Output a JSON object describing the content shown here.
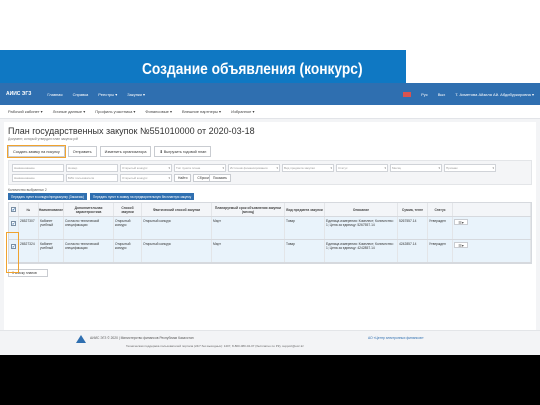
{
  "slide": {
    "title": "Создание объявления (конкурс)"
  },
  "topnav": {
    "logo": "АИИС ЭГЗ",
    "items": [
      "Главная",
      "Справка",
      "Реестры ▾",
      "Закупки ▾"
    ],
    "right": [
      "Рус",
      "Вых",
      "Т. Ахметова Айзиля Ай. Абдибуркировна ▾"
    ]
  },
  "subnav": {
    "items": [
      "Рабочий кабинет ▾",
      "Личные данные ▾",
      "Профиль участника ▾",
      "Финансовые ▾",
      "Внешние партнеры ▾",
      "Избранное ▾"
    ]
  },
  "page": {
    "title": "План государственных закупок №551010000 от 2020-03-18",
    "doc_note": "Документ, который утвердил план закупок pdf"
  },
  "toolbar": {
    "create": "Создать заявку на покупку",
    "send": "Отправить",
    "change_org": "Изменить организатора",
    "export": "Выгрузить годовой план"
  },
  "filters": {
    "row1": [
      "Наименование",
      "Номер",
      "Открытый конкурс",
      "Тип пункта плана",
      "Источник финансирования",
      "Вид предмета закупки",
      "Статус",
      "Месяц",
      "Признак"
    ],
    "row2": [
      "Наименование",
      "БИН пользователя",
      "Открытый конкурс"
    ],
    "search": "Найти",
    "reset": "Сбросить",
    "show": "Показать"
  },
  "selection": {
    "count_text": "Количество выбранных 2"
  },
  "actions": {
    "create_notice": "Передать пункт в конкурс/предзакупку (Заказчик)",
    "create_pred": "Передать пункт в заявку на предварительную бесплатную закупку"
  },
  "table": {
    "headers": [
      "",
      "№",
      "Наименование",
      "Дополнительная характеристика",
      "Способ закупки",
      "Фактический способ закупки",
      "Планируемый срок объявления закупки (месяц)",
      "Вид предмета закупки",
      "Описание",
      "Сумма, тенге",
      "Статус",
      ""
    ],
    "rows": [
      {
        "id": "26527307",
        "name": "Кабинет учебный",
        "extra": "Согласно технической спецификации",
        "method": "Открытый конкурс",
        "fact": "Открытый конкурс",
        "month": "Март",
        "kind": "Товар",
        "desc": "Единица измерения: Комплект; Количество: 1; Цена за единицу: 5267557.14",
        "sum": "5267557.14",
        "status": "Утвержден"
      },
      {
        "id": "26527324",
        "name": "Кабинет учебный",
        "extra": "Согласно технической спецификации",
        "method": "Открытый конкурс",
        "fact": "Открытый конкурс",
        "month": "Март",
        "kind": "Товар",
        "desc": "Единица измерения: Комплект; Количество: 1; Цена за единицу: 4242857.14",
        "sum": "4242857.14",
        "status": "Утвержден"
      }
    ]
  },
  "back": "К списку планов",
  "footer": {
    "line1": "АИИС ЭГЗ © 2020 | Министерство финансов Республики Казахстан",
    "line2": "Техническая поддержка пользователей портала (24/7 без выходных): 1407, 8-800-080-04-07 (бесплатно по РК), support@ecc.kz",
    "partner": "АО «Центр электронных финансов»"
  },
  "colors": {
    "ribbon": "#0f78c3",
    "nav": "#2f6fb0",
    "highlight": "#f0a32f"
  }
}
